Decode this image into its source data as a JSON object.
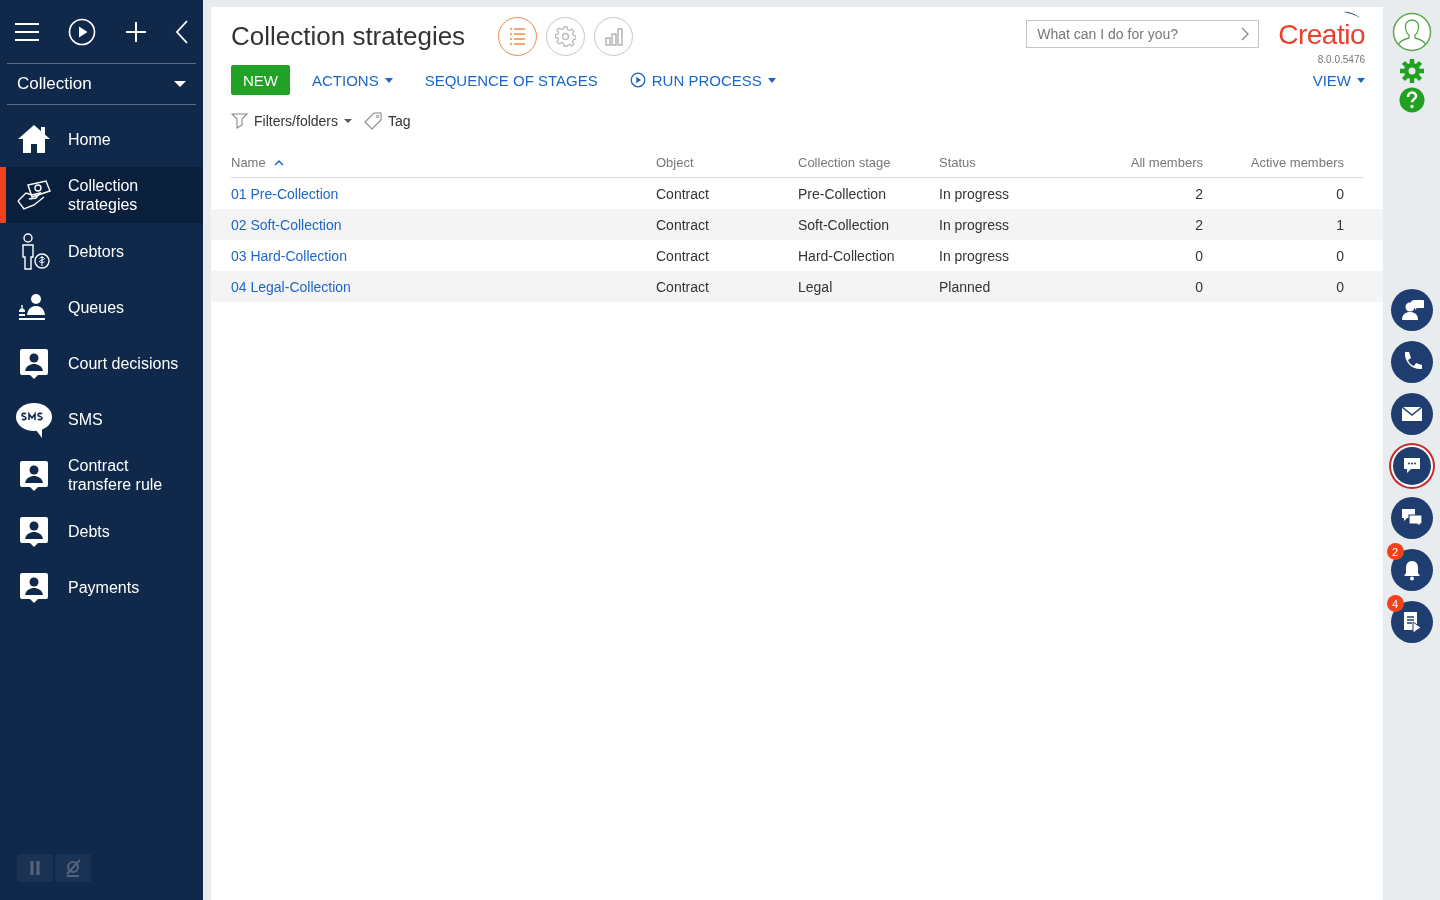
{
  "sidebar": {
    "module": "Collection",
    "items": [
      {
        "label": "Home",
        "kind": "home",
        "selected": false
      },
      {
        "label": "Collection strategies",
        "kind": "handshake",
        "selected": true
      },
      {
        "label": "Debtors",
        "kind": "debtor",
        "selected": false
      },
      {
        "label": "Queues",
        "kind": "queue",
        "selected": false
      },
      {
        "label": "Court decisions",
        "kind": "card",
        "selected": false
      },
      {
        "label": "SMS",
        "kind": "sms",
        "selected": false
      },
      {
        "label": "Contract transfere rule",
        "kind": "card",
        "selected": false
      },
      {
        "label": "Debts",
        "kind": "card",
        "selected": false
      },
      {
        "label": "Payments",
        "kind": "card",
        "selected": false
      }
    ]
  },
  "header": {
    "title": "Collection strategies",
    "view_buttons": [
      {
        "kind": "list",
        "selected": true
      },
      {
        "kind": "settings",
        "selected": false
      },
      {
        "kind": "chart",
        "selected": false
      }
    ],
    "search": {
      "placeholder": "What can I do for you?"
    },
    "logo": "Creatio",
    "version": "8.0.0.5476"
  },
  "toolbar": {
    "new": "NEW",
    "actions": "ACTIONS",
    "sequence": "SEQUENCE OF STAGES",
    "run_process": "RUN PROCESS",
    "view": "VIEW"
  },
  "filters": {
    "folders": "Filters/folders",
    "tag": "Tag"
  },
  "table": {
    "columns": [
      {
        "label": "Name",
        "sorted": true
      },
      {
        "label": "Object",
        "sorted": false
      },
      {
        "label": "Collection stage",
        "sorted": false
      },
      {
        "label": "Status",
        "sorted": false
      },
      {
        "label": "All members",
        "sorted": false
      },
      {
        "label": "Active members",
        "sorted": false
      }
    ],
    "rows": [
      [
        "01 Pre-Collection",
        "Contract",
        "Pre-Collection",
        "In progress",
        "2",
        "0"
      ],
      [
        "02 Soft-Collection",
        "Contract",
        "Soft-Collection",
        "In progress",
        "2",
        "1"
      ],
      [
        "03 Hard-Collection",
        "Contract",
        "Hard-Collection",
        "In progress",
        "0",
        "0"
      ],
      [
        "04 Legal-Collection",
        "Contract",
        "Legal",
        "Planned",
        "0",
        "0"
      ]
    ]
  },
  "right_panel": {
    "buttons": [
      {
        "kind": "contact",
        "selected": false
      },
      {
        "kind": "phone",
        "selected": false
      },
      {
        "kind": "email",
        "selected": false
      },
      {
        "kind": "chat",
        "selected": true
      },
      {
        "kind": "feed",
        "selected": false
      },
      {
        "kind": "bell",
        "selected": false,
        "badge": "2"
      },
      {
        "kind": "process",
        "selected": false,
        "badge": "4"
      }
    ]
  }
}
